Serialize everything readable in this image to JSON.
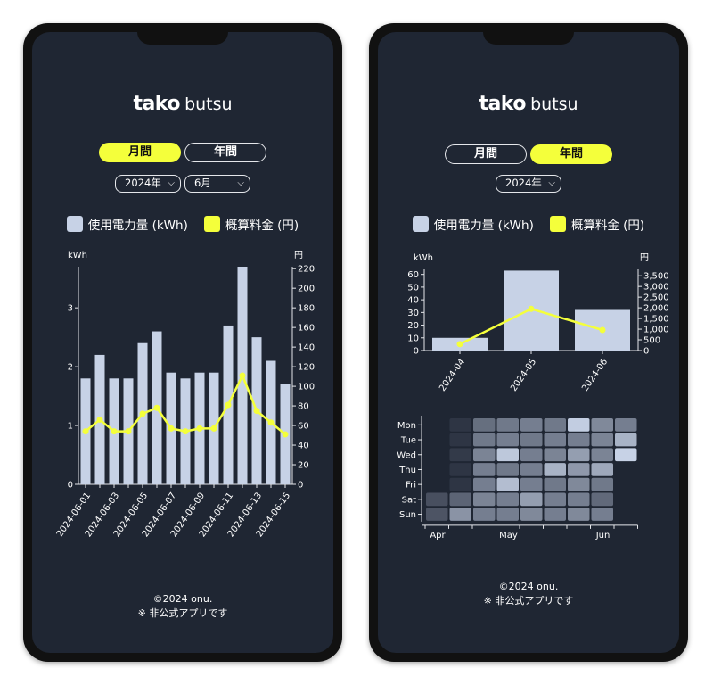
{
  "phones": [
    {
      "logo": {
        "bold": "tako",
        "light": "butsu"
      },
      "tabs": [
        {
          "label": "月間",
          "active": true
        },
        {
          "label": "年間",
          "active": false
        }
      ],
      "selects": [
        "2024年",
        "6月"
      ],
      "legend": [
        {
          "label": "使用電力量 (kWh)",
          "color": "#c7d2e6"
        },
        {
          "label": "概算料金 (円)",
          "color": "#f4ff3b"
        }
      ],
      "footer": {
        "line1": "©2024 onu.",
        "line2": "※ 非公式アプリです"
      }
    },
    {
      "logo": {
        "bold": "tako",
        "light": "butsu"
      },
      "tabs": [
        {
          "label": "月間",
          "active": false
        },
        {
          "label": "年間",
          "active": true
        }
      ],
      "selects": [
        "2024年"
      ],
      "legend": [
        {
          "label": "使用電力量 (kWh)",
          "color": "#c7d2e6"
        },
        {
          "label": "概算料金 (円)",
          "color": "#f4ff3b"
        }
      ],
      "footer": {
        "line1": "©2024 onu.",
        "line2": "※ 非公式アプリです"
      }
    }
  ],
  "chart_data": [
    {
      "type": "bar",
      "title": "",
      "ylabel": "kWh",
      "y2label": "円",
      "categories": [
        "2024-06-01",
        "2024-06-02",
        "2024-06-03",
        "2024-06-04",
        "2024-06-05",
        "2024-06-06",
        "2024-06-07",
        "2024-06-08",
        "2024-06-09",
        "2024-06-10",
        "2024-06-11",
        "2024-06-12",
        "2024-06-13",
        "2024-06-14",
        "2024-06-15"
      ],
      "xtick_labels": [
        "2024-06-01",
        "2024-06-03",
        "2024-06-05",
        "2024-06-07",
        "2024-06-09",
        "2024-06-11",
        "2024-06-13",
        "2024-06-15"
      ],
      "series": [
        {
          "name": "使用電力量 (kWh)",
          "axis": "left",
          "type": "bar",
          "color": "#c7d2e6",
          "values": [
            1.8,
            2.2,
            1.8,
            1.8,
            2.4,
            2.6,
            1.9,
            1.8,
            1.9,
            1.9,
            2.7,
            3.7,
            2.5,
            2.1,
            1.7
          ]
        },
        {
          "name": "概算料金 (円)",
          "axis": "right",
          "type": "line",
          "color": "#f4ff3b",
          "values": [
            54,
            66,
            54,
            54,
            72,
            78,
            57,
            54,
            57,
            57,
            81,
            111,
            75,
            63,
            51
          ]
        }
      ],
      "ylim": [
        0,
        3.7
      ],
      "yticks": [
        0,
        1,
        2,
        3
      ],
      "y2lim": [
        0,
        222
      ],
      "y2ticks": [
        0,
        20,
        40,
        60,
        80,
        100,
        120,
        140,
        160,
        180,
        200,
        220
      ],
      "grid": false,
      "legend": "top"
    },
    {
      "type": "bar",
      "title": "",
      "ylabel": "kWh",
      "y2label": "円",
      "categories": [
        "2024-04",
        "2024-05",
        "2024-06"
      ],
      "series": [
        {
          "name": "使用電力量 (kWh)",
          "axis": "left",
          "type": "bar",
          "color": "#c7d2e6",
          "values": [
            10,
            63,
            32
          ]
        },
        {
          "name": "概算料金 (円)",
          "axis": "right",
          "type": "line",
          "color": "#f4ff3b",
          "values": [
            300,
            1950,
            960
          ]
        }
      ],
      "ylim": [
        0,
        64
      ],
      "yticks": [
        0,
        10,
        20,
        30,
        40,
        50,
        60
      ],
      "y2lim": [
        0,
        3800
      ],
      "y2ticks": [
        0,
        500,
        1000,
        1500,
        2000,
        2500,
        3000,
        3500
      ],
      "y2tick_labels": [
        "0",
        "500",
        "1,000",
        "1,500",
        "2,000",
        "2,500",
        "3,000",
        "3,500"
      ],
      "grid": false,
      "legend": "top"
    },
    {
      "type": "heatmap",
      "rows": [
        "Mon",
        "Tue",
        "Wed",
        "Thu",
        "Fri",
        "Sat",
        "Sun"
      ],
      "month_labels": [
        {
          "label": "Apr",
          "week": 0
        },
        {
          "label": "May",
          "week": 3
        },
        {
          "label": "Jun",
          "week": 7
        }
      ],
      "weeks": 9,
      "values": [
        [
          null,
          0.6,
          1.7,
          1.9,
          2.0,
          1.9,
          3.5,
          2.2,
          2.0
        ],
        [
          null,
          0.6,
          1.9,
          2.0,
          1.9,
          2.0,
          2.0,
          2.1,
          3.0
        ],
        [
          null,
          0.7,
          2.1,
          3.4,
          2.0,
          2.1,
          2.6,
          2.1,
          3.6
        ],
        [
          null,
          0.6,
          2.0,
          1.9,
          2.0,
          3.0,
          2.5,
          2.8,
          null
        ],
        [
          null,
          0.6,
          2.0,
          3.2,
          2.0,
          1.9,
          2.2,
          1.9,
          null
        ],
        [
          1.1,
          1.5,
          2.1,
          2.0,
          2.6,
          2.0,
          2.0,
          1.6,
          null
        ],
        [
          1.2,
          2.4,
          2.0,
          2.0,
          2.2,
          2.0,
          2.2,
          2.0,
          null
        ]
      ],
      "color_low": "#2e3544",
      "color_high": "#c7d2e6"
    }
  ]
}
